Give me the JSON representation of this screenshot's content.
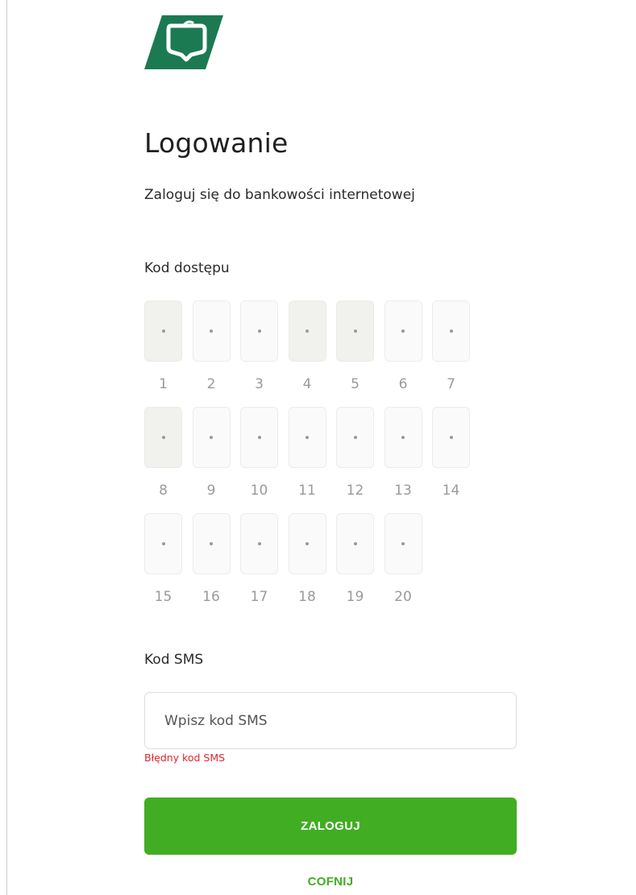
{
  "colors": {
    "brand": "#1b7a52",
    "accent": "#41ad23",
    "error": "#e8232e"
  },
  "logo": {
    "icon": "bank-shield-logo"
  },
  "title": "Logowanie",
  "subtitle": "Zaloguj się do bankowości internetowej",
  "access_code": {
    "label": "Kod dostępu",
    "positions": [
      {
        "num": "1",
        "active": true
      },
      {
        "num": "2",
        "active": false
      },
      {
        "num": "3",
        "active": false
      },
      {
        "num": "4",
        "active": true
      },
      {
        "num": "5",
        "active": true
      },
      {
        "num": "6",
        "active": false
      },
      {
        "num": "7",
        "active": false
      },
      {
        "num": "8",
        "active": true
      },
      {
        "num": "9",
        "active": false
      },
      {
        "num": "10",
        "active": false
      },
      {
        "num": "11",
        "active": false
      },
      {
        "num": "12",
        "active": false
      },
      {
        "num": "13",
        "active": false
      },
      {
        "num": "14",
        "active": false
      },
      {
        "num": "15",
        "active": false
      },
      {
        "num": "16",
        "active": false
      },
      {
        "num": "17",
        "active": false
      },
      {
        "num": "18",
        "active": false
      },
      {
        "num": "19",
        "active": false
      },
      {
        "num": "20",
        "active": false
      }
    ]
  },
  "sms": {
    "label": "Kod SMS",
    "placeholder": "Wpisz kod SMS",
    "value": "",
    "error": "Błędny kod SMS"
  },
  "buttons": {
    "login": "ZALOGUJ",
    "back": "COFNIJ"
  }
}
